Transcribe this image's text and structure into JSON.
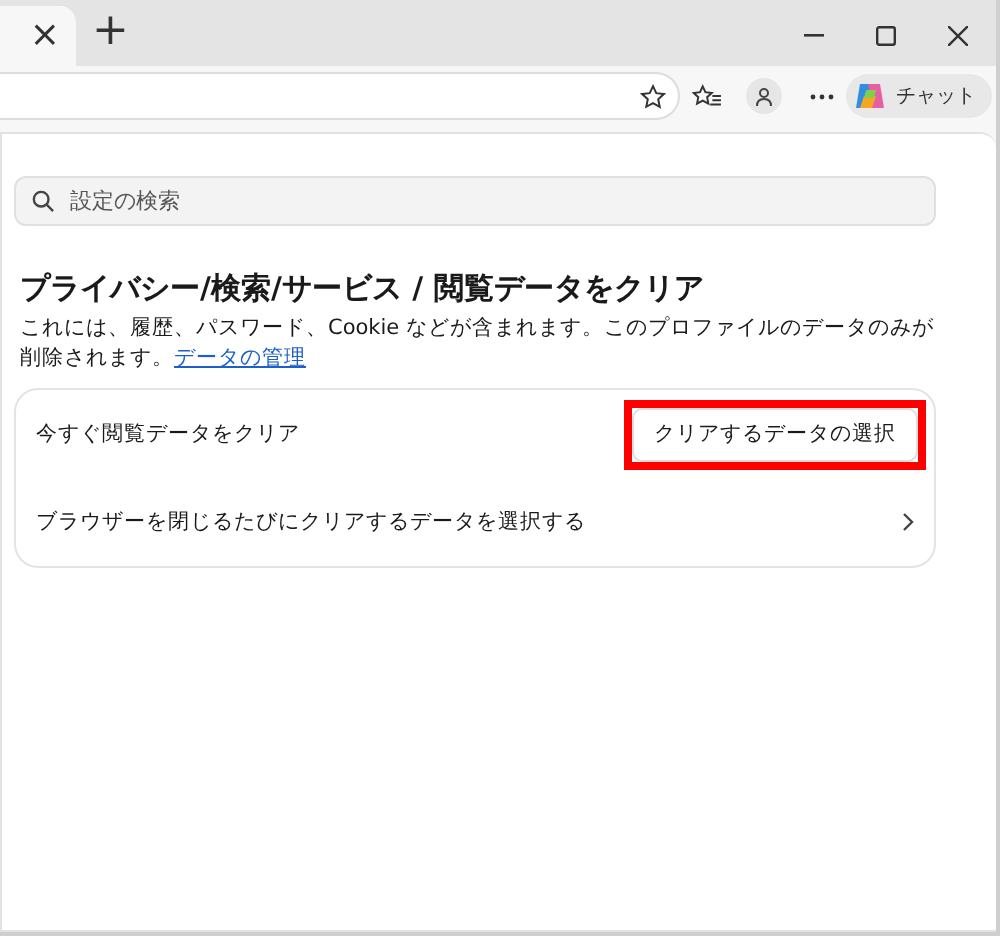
{
  "browser": {
    "tab_close": "×",
    "new_tab": "+",
    "chat_button": "チャット"
  },
  "search": {
    "placeholder": "設定の検索"
  },
  "page": {
    "title": "プライバシー/検索/サービス / 閲覧データをクリア",
    "description": "これには、履歴、パスワード、Cookie などが含まれます。このプロファイルのデータのみが削除されます。",
    "link": "データの管理"
  },
  "settings": [
    {
      "kind": "button",
      "label": "今すぐ閲覧データをクリア",
      "button": "クリアするデータの選択",
      "highlighted": true
    },
    {
      "kind": "link",
      "label": "ブラウザーを閉じるたびにクリアするデータを選択する"
    }
  ]
}
